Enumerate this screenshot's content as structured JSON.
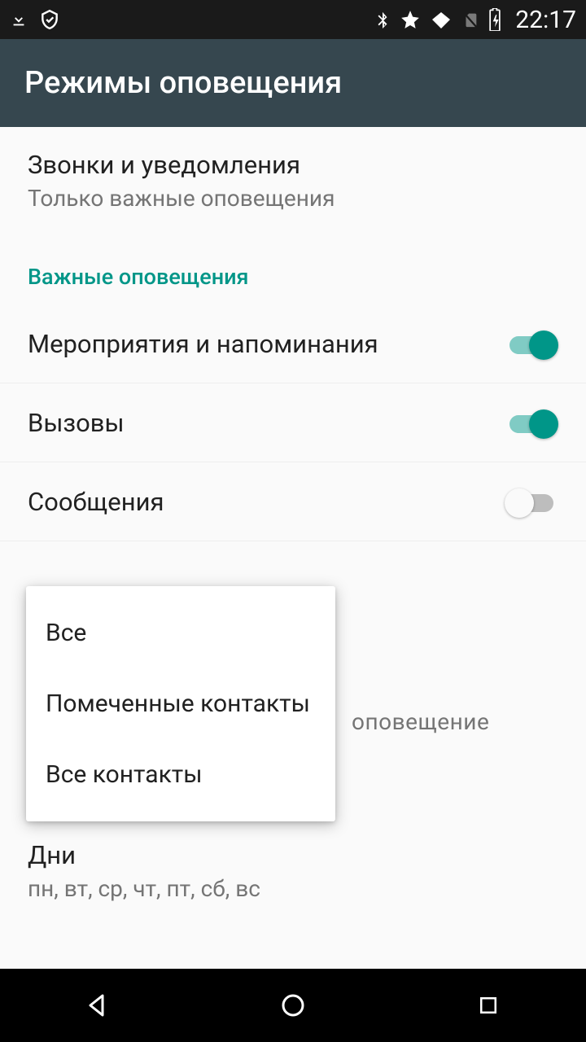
{
  "status": {
    "time": "22:17"
  },
  "appbar": {
    "title": "Режимы оповещения"
  },
  "settings": {
    "calls_notif": {
      "title": "Звонки и уведомления",
      "sub": "Только важные оповещения"
    },
    "section_important": "Важные оповещения",
    "events": {
      "title": "Мероприятия и напоминания"
    },
    "calls": {
      "title": "Вызовы"
    },
    "messages": {
      "title": "Сообщения"
    },
    "bg_hint": "оповещение"
  },
  "popup": {
    "all": "Все",
    "starred": "Помеченные контакты",
    "all_contacts": "Все контакты"
  },
  "days": {
    "title": "Дни",
    "sub": "пн, вт, ср, чт, пт, сб, вс"
  }
}
